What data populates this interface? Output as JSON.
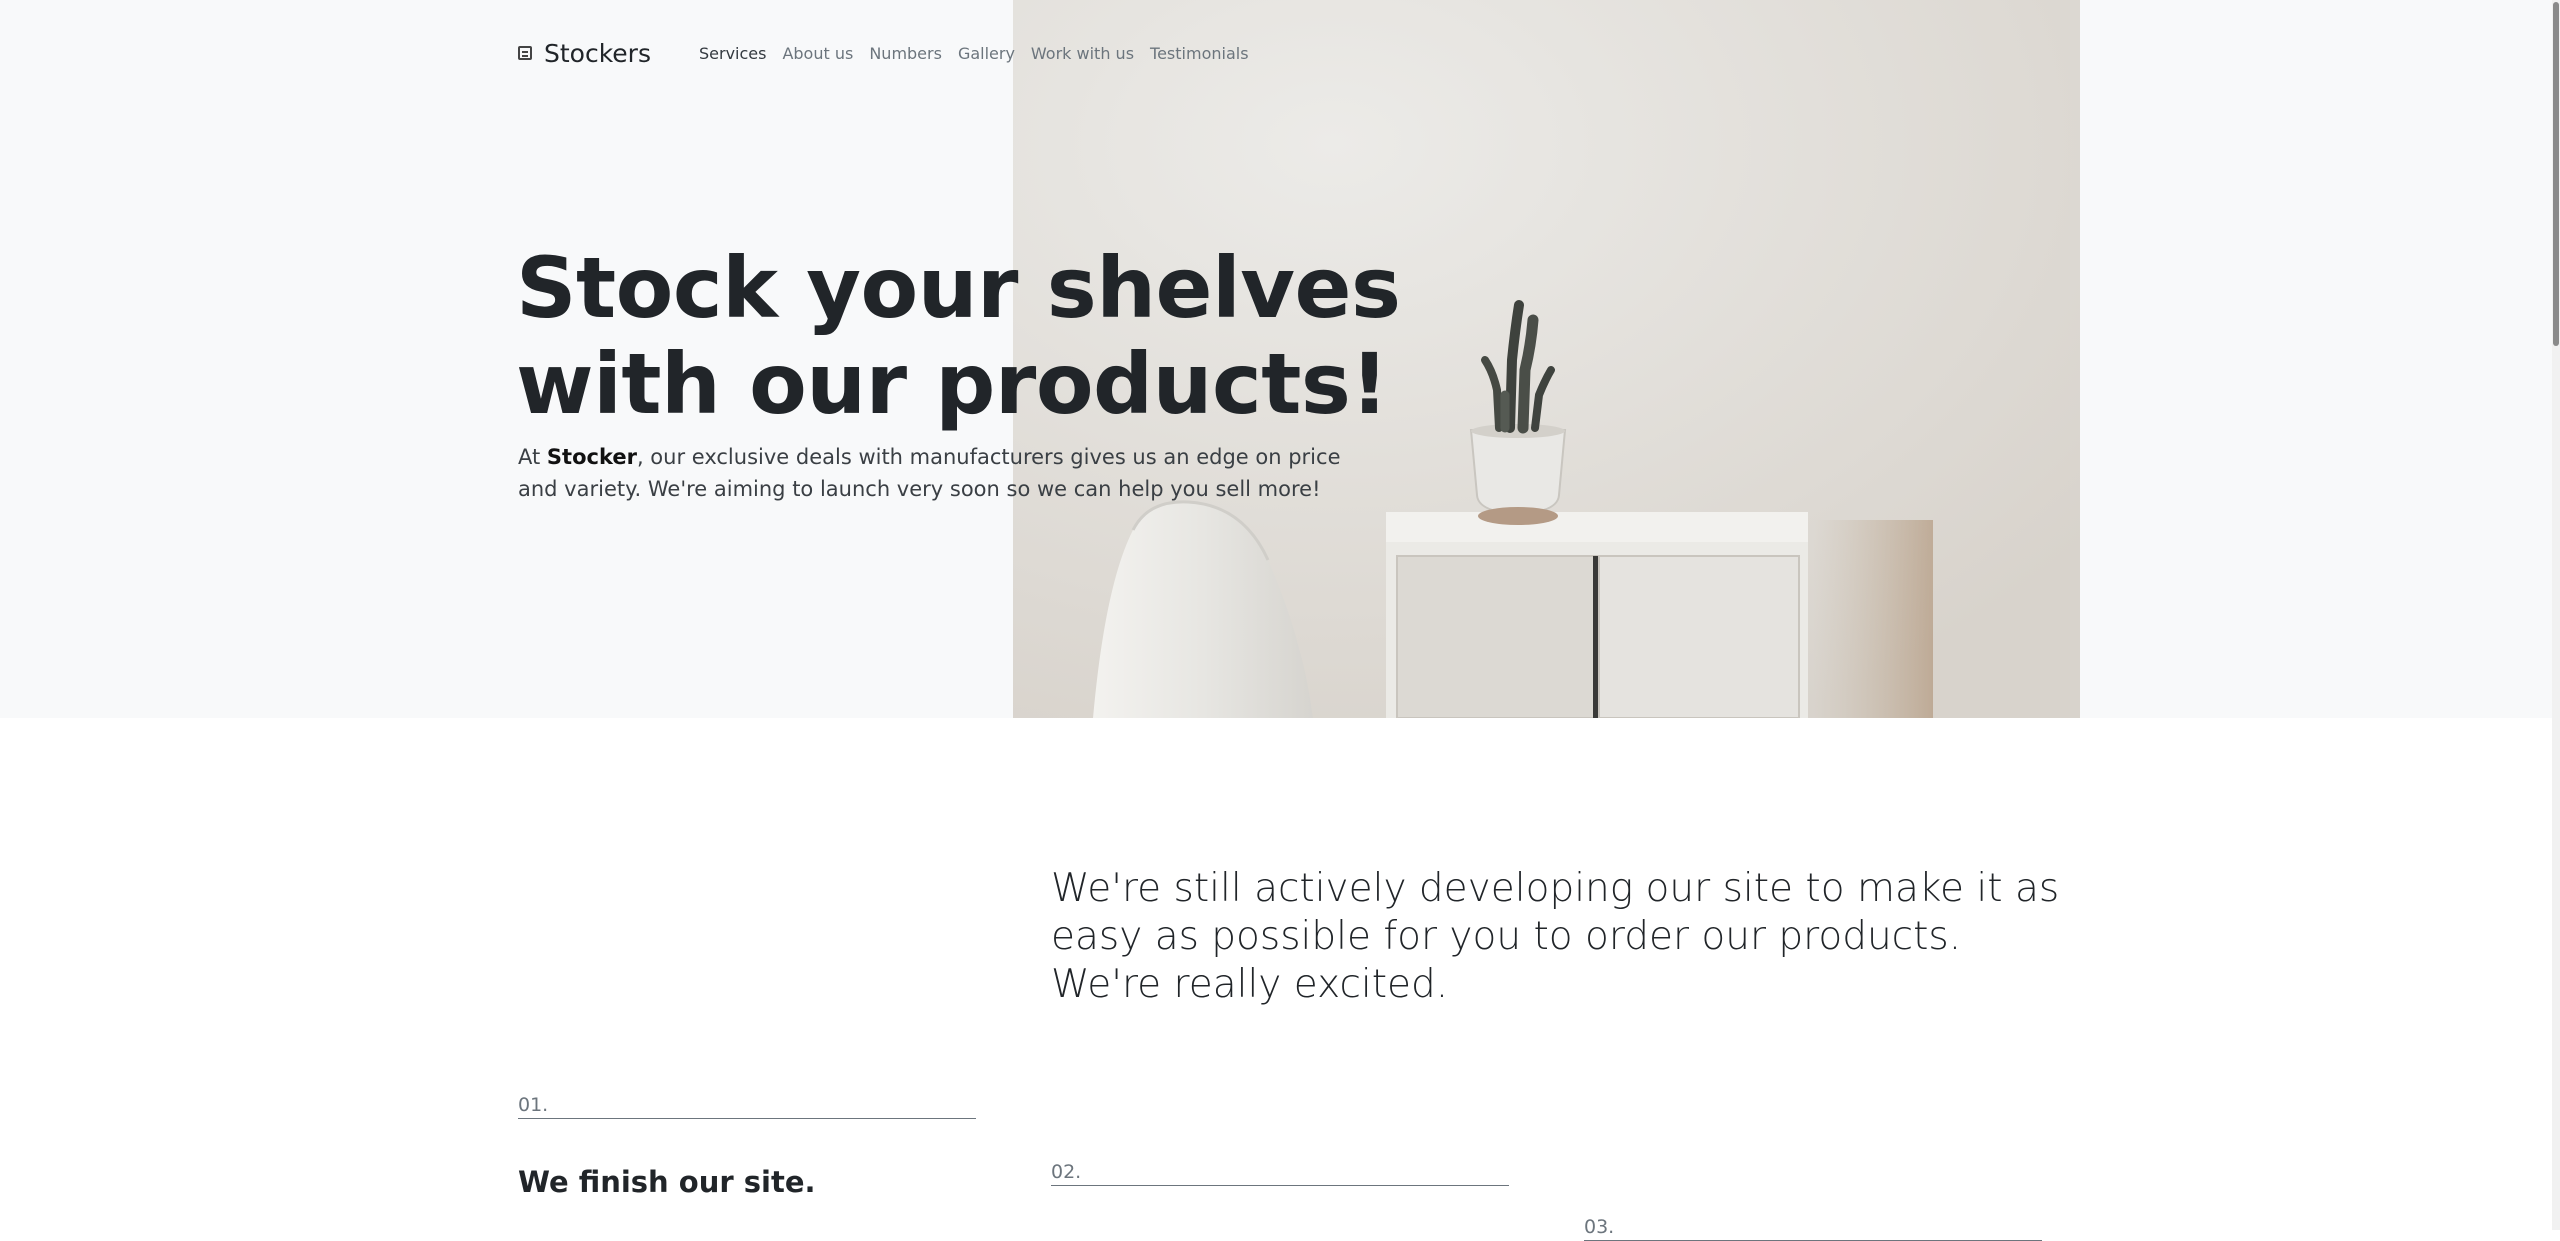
{
  "brand": {
    "name": "Stockers",
    "icon": "building-icon"
  },
  "nav": {
    "items": [
      {
        "label": "Services",
        "active": true
      },
      {
        "label": "About us",
        "active": false
      },
      {
        "label": "Numbers",
        "active": false
      },
      {
        "label": "Gallery",
        "active": false
      },
      {
        "label": "Work with us",
        "active": false
      },
      {
        "label": "Testimonials",
        "active": false
      }
    ]
  },
  "hero": {
    "title_line1": "Stock your shelves",
    "title_line2": "with our products!",
    "lead_prefix": "At ",
    "lead_brand": "Stocker",
    "lead_suffix": ", our exclusive deals with manufacturers gives us an edge on price and variety. We're aiming to launch very soon so we can help you sell more!"
  },
  "intro": {
    "text": "We're still actively developing our site to make it as easy as possible for you to order our products. We're really excited."
  },
  "steps": [
    {
      "number": "01.",
      "title": "We finish our site."
    },
    {
      "number": "02.",
      "title": ""
    },
    {
      "number": "03.",
      "title": ""
    }
  ],
  "colors": {
    "hero_background": "#f8f9fa",
    "text": "#212529",
    "muted": "#6c757d"
  }
}
